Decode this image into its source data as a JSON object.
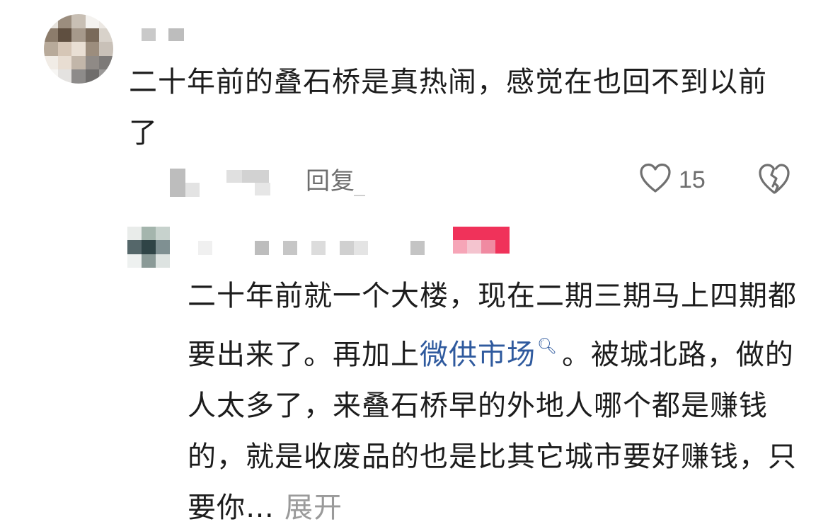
{
  "comment": {
    "text": "二十年前的叠石桥是真热闹，感觉在也回不到以前了",
    "reply_label": "回复",
    "like_count": "15",
    "icons": {
      "like": "heart-outline-icon",
      "dislike": "broken-heart-icon"
    }
  },
  "reply": {
    "text_before_link": "二十年前就一个大楼，现在二期三期马上四期都要出来了。再加上",
    "link_text": "微供市场",
    "text_after_link": "。被城北路，做的人太多了，来叠石桥早的外地人哪个都是赚钱的，就是收废品的也是比其它城市要好赚钱，只要你…",
    "expand_label": "展开",
    "icons": {
      "link_search": "search-icon"
    }
  },
  "colors": {
    "text": "#1c1c1c",
    "secondary": "#6e6e6e",
    "link": "#2f5a9e",
    "expand": "#9a9a9a",
    "badge": "#f0325a"
  }
}
